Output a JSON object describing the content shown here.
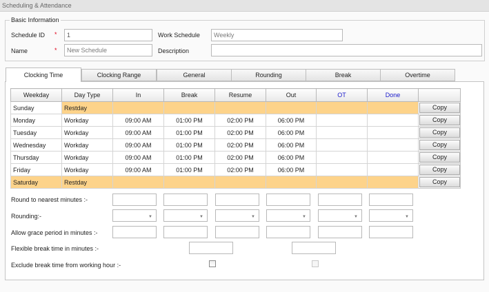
{
  "window": {
    "title": "Scheduling & Attendance"
  },
  "basic_info": {
    "legend": "Basic Information",
    "schedule_id_label": "Schedule ID",
    "schedule_id_value": "1",
    "required_mark": "*",
    "name_label": "Name",
    "name_placeholder": "New Schedule",
    "work_schedule_label": "Work Schedule",
    "work_schedule_value": "Weekly",
    "description_label": "Description",
    "description_value": ""
  },
  "tabs": [
    {
      "label": "Clocking Time",
      "active": true
    },
    {
      "label": "Clocking Range",
      "active": false
    },
    {
      "label": "General",
      "active": false
    },
    {
      "label": "Rounding",
      "active": false
    },
    {
      "label": "Break",
      "active": false
    },
    {
      "label": "Overtime",
      "active": false
    }
  ],
  "grid": {
    "columns": [
      "Weekday",
      "Day Type",
      "In",
      "Break",
      "Resume",
      "Out",
      "OT",
      "Done",
      ""
    ],
    "copy_label": "Copy",
    "highlight_color": "#fdd38a",
    "header_link_color": "#1a1acc",
    "rows": [
      {
        "weekday": "Sunday",
        "day_type": "Restday",
        "in": "",
        "break": "",
        "resume": "",
        "out": "",
        "ot": "",
        "done": "",
        "highlight": true
      },
      {
        "weekday": "Monday",
        "day_type": "Workday",
        "in": "09:00 AM",
        "break": "01:00 PM",
        "resume": "02:00 PM",
        "out": "06:00 PM",
        "ot": "",
        "done": "",
        "highlight": false
      },
      {
        "weekday": "Tuesday",
        "day_type": "Workday",
        "in": "09:00 AM",
        "break": "01:00 PM",
        "resume": "02:00 PM",
        "out": "06:00 PM",
        "ot": "",
        "done": "",
        "highlight": false
      },
      {
        "weekday": "Wednesday",
        "day_type": "Workday",
        "in": "09:00 AM",
        "break": "01:00 PM",
        "resume": "02:00 PM",
        "out": "06:00 PM",
        "ot": "",
        "done": "",
        "highlight": false
      },
      {
        "weekday": "Thursday",
        "day_type": "Workday",
        "in": "09:00 AM",
        "break": "01:00 PM",
        "resume": "02:00 PM",
        "out": "06:00 PM",
        "ot": "",
        "done": "",
        "highlight": false
      },
      {
        "weekday": "Friday",
        "day_type": "Workday",
        "in": "09:00 AM",
        "break": "01:00 PM",
        "resume": "02:00 PM",
        "out": "06:00 PM",
        "ot": "",
        "done": "",
        "highlight": false
      },
      {
        "weekday": "Saturday",
        "day_type": "Restday",
        "in": "",
        "break": "",
        "resume": "",
        "out": "",
        "ot": "",
        "done": "",
        "highlight": true
      }
    ]
  },
  "options": {
    "round_label": "Round to nearest minutes :-",
    "rounding_label": "Rounding:-",
    "grace_label": "Allow grace period in minutes :-",
    "flex_label": "Flexible break time in minutes :-",
    "exclude_label": "Exclude break time from working hour :-",
    "exclude_break_checked": false,
    "exclude_resume_checked": false,
    "exclude_resume_enabled": false,
    "dropdown_icon": "chevron-down-icon"
  }
}
